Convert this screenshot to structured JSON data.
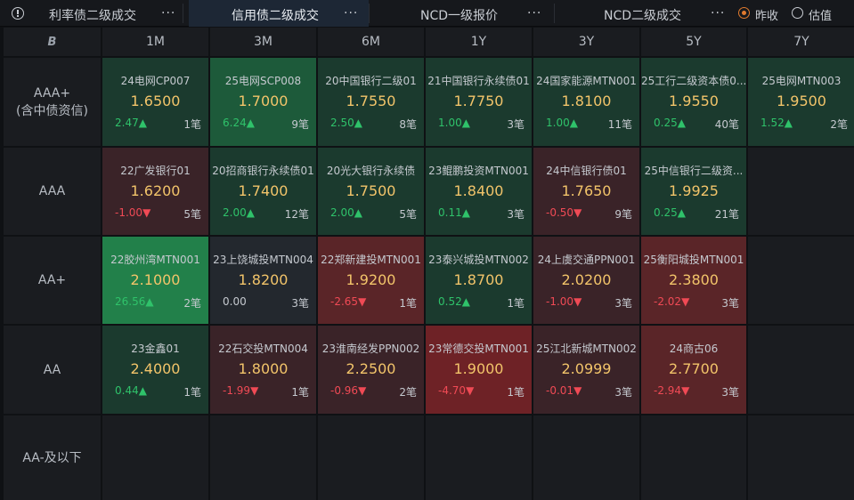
{
  "tabs": [
    {
      "label": "利率债二级成交",
      "more": "···",
      "active": false
    },
    {
      "label": "信用债二级成交",
      "more": "···",
      "active": true
    },
    {
      "label": "NCD一级报价",
      "more": "···",
      "active": false
    },
    {
      "label": "NCD二级成交",
      "more": "···",
      "active": false
    }
  ],
  "price_mode": {
    "options": [
      "昨收",
      "估值"
    ],
    "selected": "昨收"
  },
  "corner_icon": "logo-icon",
  "columns": [
    "1M",
    "3M",
    "6M",
    "1Y",
    "3Y",
    "5Y",
    "7Y"
  ],
  "rows": [
    {
      "label_line1": "AAA+",
      "label_line2": "(含中债资信)",
      "cells": [
        {
          "name": "24电网CP007",
          "yield": "1.6500",
          "change": "2.47",
          "dir": "up",
          "count": "1笔",
          "tone": "bg-dgreen"
        },
        {
          "name": "25电网SCP008",
          "yield": "1.7000",
          "change": "6.24",
          "dir": "up",
          "count": "9笔",
          "tone": "bg-mgreen"
        },
        {
          "name": "20中国银行二级01",
          "yield": "1.7550",
          "change": "2.50",
          "dir": "up",
          "count": "8笔",
          "tone": "bg-dgreen"
        },
        {
          "name": "21中国银行永续债01",
          "yield": "1.7750",
          "change": "1.00",
          "dir": "up",
          "count": "3笔",
          "tone": "bg-dgreen"
        },
        {
          "name": "24国家能源MTN001",
          "yield": "1.8100",
          "change": "1.00",
          "dir": "up",
          "count": "11笔",
          "tone": "bg-dgreen"
        },
        {
          "name": "25工行二级资本债0...",
          "yield": "1.9550",
          "change": "0.25",
          "dir": "up",
          "count": "40笔",
          "tone": "bg-dgreen"
        },
        {
          "name": "25电网MTN003",
          "yield": "1.9500",
          "change": "1.52",
          "dir": "up",
          "count": "2笔",
          "tone": "bg-dgreen"
        }
      ]
    },
    {
      "label_line1": "AAA",
      "label_line2": "",
      "cells": [
        {
          "name": "22广发银行01",
          "yield": "1.6200",
          "change": "-1.00",
          "dir": "down",
          "count": "5笔",
          "tone": "bg-dred"
        },
        {
          "name": "20招商银行永续债01",
          "yield": "1.7400",
          "change": "2.00",
          "dir": "up",
          "count": "12笔",
          "tone": "bg-dgreen"
        },
        {
          "name": "20光大银行永续债",
          "yield": "1.7500",
          "change": "2.00",
          "dir": "up",
          "count": "5笔",
          "tone": "bg-dgreen"
        },
        {
          "name": "23鲲鹏投资MTN001",
          "yield": "1.8400",
          "change": "0.11",
          "dir": "up",
          "count": "3笔",
          "tone": "bg-dgreen"
        },
        {
          "name": "24中信银行债01",
          "yield": "1.7650",
          "change": "-0.50",
          "dir": "down",
          "count": "9笔",
          "tone": "bg-dred"
        },
        {
          "name": "25中信银行二级资...",
          "yield": "1.9925",
          "change": "0.25",
          "dir": "up",
          "count": "21笔",
          "tone": "bg-dgreen"
        },
        null
      ]
    },
    {
      "label_line1": "AA+",
      "label_line2": "",
      "cells": [
        {
          "name": "22胶州湾MTN001",
          "yield": "2.1000",
          "change": "26.56",
          "dir": "up",
          "count": "2笔",
          "tone": "bg-bgreen"
        },
        {
          "name": "23上饶城投MTN004",
          "yield": "1.8200",
          "change": "0.00",
          "dir": "flat",
          "count": "3笔",
          "tone": "bg-neutral"
        },
        {
          "name": "22郑新建投MTN001",
          "yield": "1.9200",
          "change": "-2.65",
          "dir": "down",
          "count": "1笔",
          "tone": "bg-mred"
        },
        {
          "name": "23泰兴城投MTN002",
          "yield": "1.8700",
          "change": "0.52",
          "dir": "up",
          "count": "1笔",
          "tone": "bg-dgreen"
        },
        {
          "name": "24上虞交通PPN001",
          "yield": "2.0200",
          "change": "-1.00",
          "dir": "down",
          "count": "3笔",
          "tone": "bg-dred"
        },
        {
          "name": "25衡阳城投MTN001",
          "yield": "2.3800",
          "change": "-2.02",
          "dir": "down",
          "count": "3笔",
          "tone": "bg-mred"
        },
        null
      ]
    },
    {
      "label_line1": "AA",
      "label_line2": "",
      "cells": [
        {
          "name": "23金鑫01",
          "yield": "2.4000",
          "change": "0.44",
          "dir": "up",
          "count": "1笔",
          "tone": "bg-dgreen"
        },
        {
          "name": "22石交投MTN004",
          "yield": "1.8000",
          "change": "-1.99",
          "dir": "down",
          "count": "1笔",
          "tone": "bg-dred"
        },
        {
          "name": "23淮南经发PPN002",
          "yield": "2.2500",
          "change": "-0.96",
          "dir": "down",
          "count": "2笔",
          "tone": "bg-dred"
        },
        {
          "name": "23常德交投MTN001",
          "yield": "1.9000",
          "change": "-4.70",
          "dir": "down",
          "count": "1笔",
          "tone": "bg-bred"
        },
        {
          "name": "25江北新城MTN002",
          "yield": "2.0999",
          "change": "-0.01",
          "dir": "down",
          "count": "3笔",
          "tone": "bg-dred"
        },
        {
          "name": "24商古06",
          "yield": "2.7700",
          "change": "-2.94",
          "dir": "down",
          "count": "3笔",
          "tone": "bg-mred"
        },
        null
      ]
    },
    {
      "label_line1": "AA-及以下",
      "label_line2": "",
      "cells": [
        null,
        null,
        null,
        null,
        null,
        null,
        null
      ]
    }
  ],
  "arrows": {
    "up": "▲",
    "down": "▼",
    "flat": ""
  },
  "colors": {
    "up": "#2fc26a",
    "down": "#f04a55",
    "yield": "#f2c46a",
    "accent": "#e07a2e"
  }
}
